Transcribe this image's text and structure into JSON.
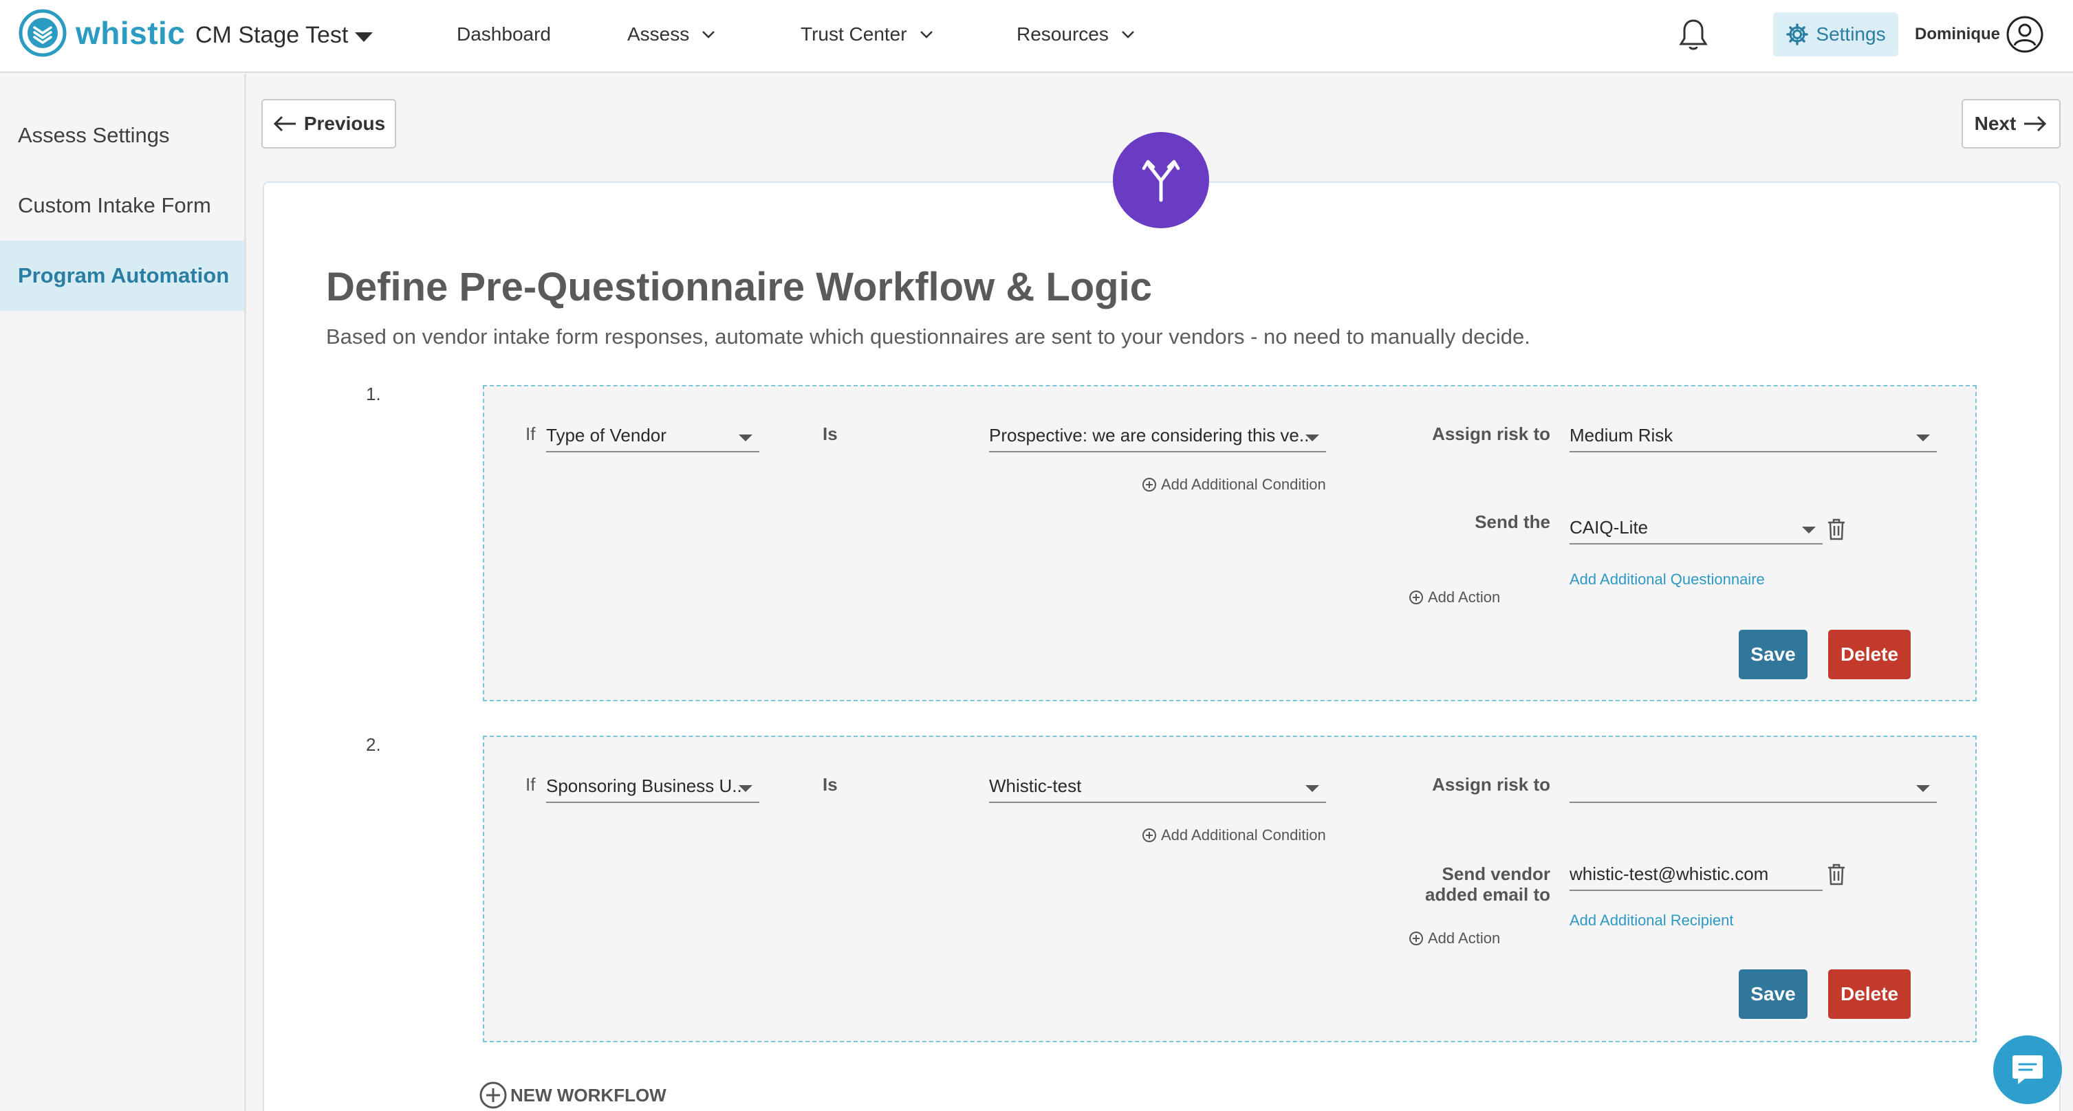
{
  "brand": {
    "name": "whistic",
    "color": "#2b9bc2"
  },
  "org": {
    "name": "CM Stage Test"
  },
  "nav": {
    "dashboard": "Dashboard",
    "assess": "Assess",
    "trust_center": "Trust Center",
    "resources": "Resources"
  },
  "settings": {
    "label": "Settings"
  },
  "user": {
    "name": "Dominique"
  },
  "sidebar": {
    "items": [
      {
        "label": "Assess Settings",
        "active": false
      },
      {
        "label": "Custom Intake Form",
        "active": false
      },
      {
        "label": "Program Automation",
        "active": true
      }
    ]
  },
  "pager": {
    "previous": "Previous",
    "next": "Next"
  },
  "page": {
    "title": "Define Pre-Questionnaire Workflow & Logic",
    "subtitle": "Based on vendor intake form responses, automate which questionnaires are sent to your vendors - no need to manually decide.",
    "badge_icon": "workflow-split-icon",
    "accent": "#6a3cc4"
  },
  "workflows": [
    {
      "number": "1.",
      "if_label": "If",
      "field": "Type of Vendor",
      "is_label": "Is",
      "value": "Prospective: we are considering this ve...",
      "add_condition": "Add Additional Condition",
      "assign_label": "Assign risk to",
      "risk": "Medium Risk",
      "action_label": "Send the",
      "action_value": "CAIQ-Lite",
      "add_more": "Add Additional Questionnaire",
      "add_action": "Add Action",
      "save": "Save",
      "delete": "Delete"
    },
    {
      "number": "2.",
      "if_label": "If",
      "field": "Sponsoring Business U...",
      "is_label": "Is",
      "value": "Whistic-test",
      "add_condition": "Add Additional Condition",
      "assign_label": "Assign risk to",
      "risk": "",
      "action_label_line1": "Send vendor",
      "action_label_line2": "added email to",
      "action_value": "whistic-test@whistic.com",
      "add_more": "Add Additional Recipient",
      "add_action": "Add Action",
      "save": "Save",
      "delete": "Delete"
    }
  ],
  "new_workflow": "NEW WORKFLOW",
  "colors": {
    "save": "#31779c",
    "delete": "#c23a2c",
    "link": "#2e98c2",
    "active_bg": "#d8ecf3"
  }
}
